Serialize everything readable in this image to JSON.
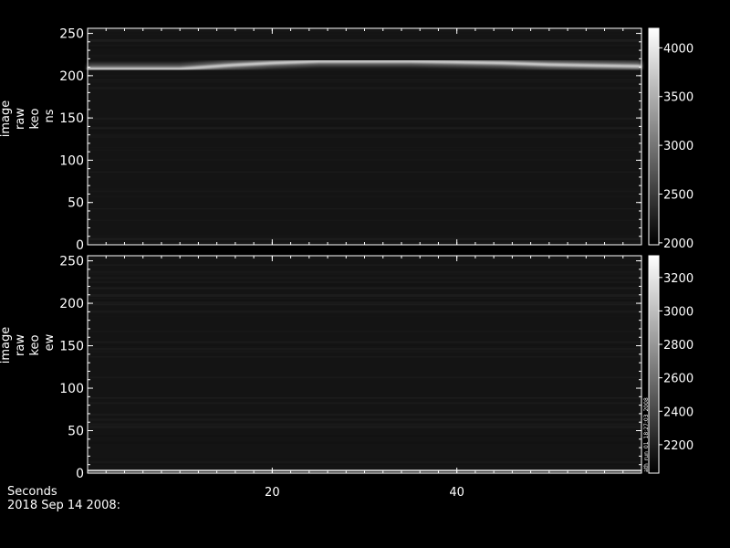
{
  "chart_data": [
    {
      "type": "heatmap",
      "ylabel": [
        "image",
        "raw",
        "keo",
        "ns"
      ],
      "xlim": [
        0,
        60
      ],
      "ylim": [
        0,
        256
      ],
      "yticks": [
        0,
        50,
        100,
        150,
        200,
        250
      ],
      "xticks": [
        20,
        40
      ],
      "xtick_labels": [
        "",
        ""
      ],
      "grid": false,
      "colorbar": {
        "range": [
          1980,
          4200
        ],
        "ticks": [
          2000,
          2500,
          3000,
          3500,
          4000
        ]
      },
      "bright_band_y": [
        [
          0,
          208
        ],
        [
          5,
          208
        ],
        [
          10,
          208
        ],
        [
          15,
          212
        ],
        [
          20,
          215
        ],
        [
          25,
          217
        ],
        [
          30,
          217
        ],
        [
          35,
          217
        ],
        [
          40,
          216
        ],
        [
          45,
          215
        ],
        [
          50,
          213
        ],
        [
          55,
          212
        ],
        [
          60,
          211
        ]
      ]
    },
    {
      "type": "heatmap",
      "ylabel": [
        "image",
        "raw",
        "keo",
        "ew"
      ],
      "xlim": [
        0,
        60
      ],
      "ylim": [
        0,
        256
      ],
      "yticks": [
        0,
        50,
        100,
        150,
        200,
        250
      ],
      "xticks": [
        20,
        40
      ],
      "xtick_labels": [
        "20",
        "40"
      ],
      "grid": false,
      "colorbar": {
        "range": [
          2030,
          3330
        ],
        "ticks": [
          2200,
          2400,
          2600,
          2800,
          3000,
          3200
        ]
      },
      "bright_band_y": [
        [
          0,
          248
        ],
        [
          60,
          248
        ]
      ],
      "bottom_band_y": [
        [
          0,
          3
        ],
        [
          60,
          3
        ]
      ]
    }
  ],
  "xlabel": "Seconds",
  "date": "2018 Sep 14 2008:",
  "side_label": "ath_run_01_18:27:03_2008"
}
